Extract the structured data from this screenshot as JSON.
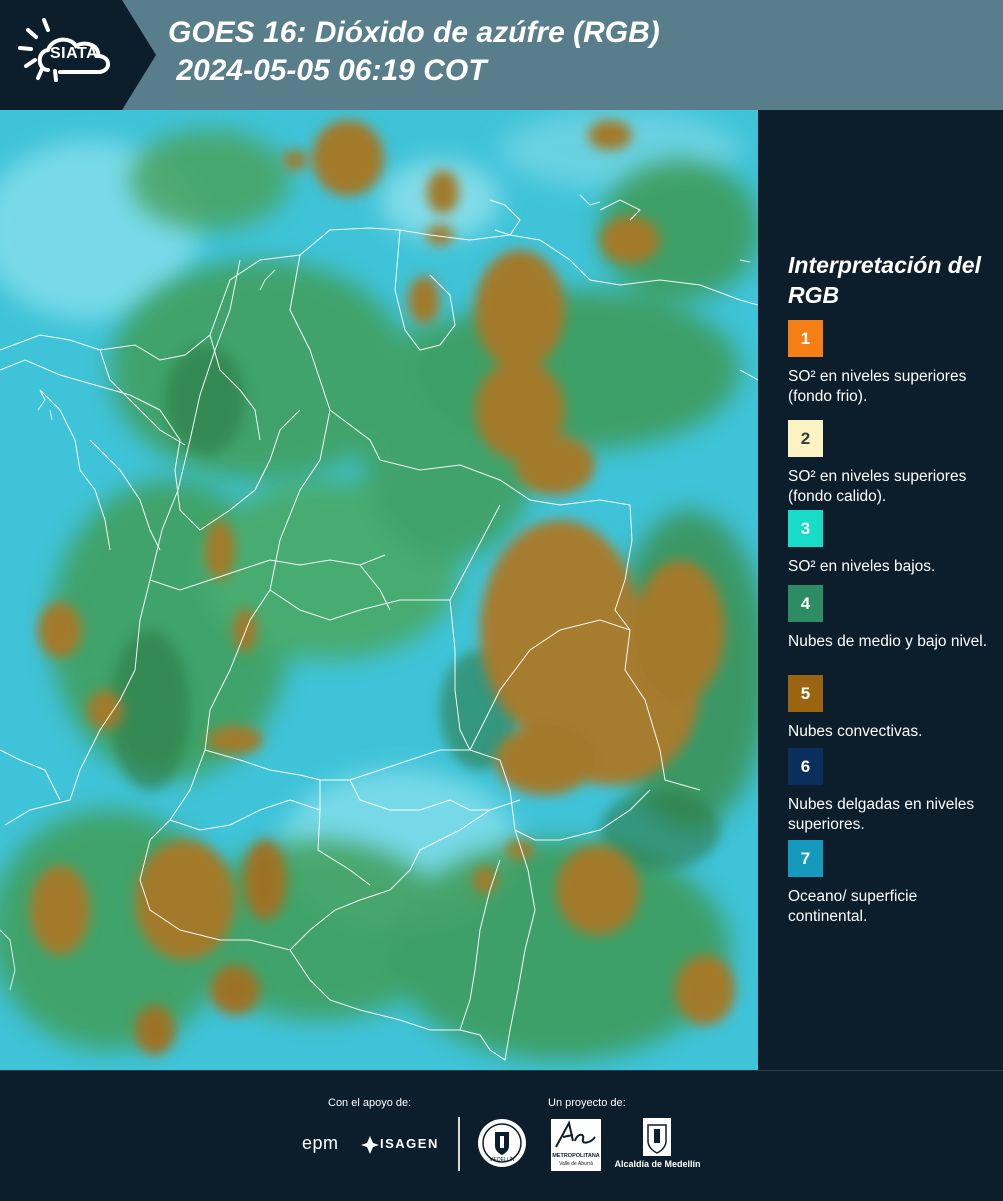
{
  "header": {
    "logo_text": "SIATA",
    "title_line1": "GOES 16: Dióxido de azúfre (RGB)",
    "title_line2": " 2024-05-05 06:19 COT"
  },
  "legend": {
    "title": "Interpretación del RGB",
    "items": [
      {
        "number": "1",
        "label": "SO² en niveles superiores (fondo frio).",
        "color": "#f57f15"
      },
      {
        "number": "2",
        "label": "SO² en niveles superiores (fondo calido).",
        "color": "#fbf3c3"
      },
      {
        "number": "3",
        "label": "SO² en niveles bajos.",
        "color": "#18dcc8"
      },
      {
        "number": "4",
        "label": "Nubes de medio y bajo nivel.",
        "color": "#2e8c64"
      },
      {
        "number": "5",
        "label": "Nubes convectivas.",
        "color": "#9b6411"
      },
      {
        "number": "6",
        "label": "Nubes delgadas en niveles superiores.",
        "color": "#0a2f5c"
      },
      {
        "number": "7",
        "label": "Oceano/ superficie continental.",
        "color": "#1599bd"
      }
    ]
  },
  "footer": {
    "support_label": "Con el apoyo de:",
    "project_label": "Un proyecto de:",
    "epm": "epm",
    "isagen": "ISAGEN",
    "metro_name": "METROPOLITANA",
    "metro_sub": "Valle de Aburrá",
    "alcaldia": "Alcaldía de Medellín",
    "medellin_seal": "MEDELLÍN"
  },
  "colors": {
    "header_bg": "#587d8b",
    "panel_bg": "#0c1e2c",
    "ocean_cyan": "#3fc3d8",
    "convective_brown": "#a27a2c",
    "mid_cloud_green": "#3f9e58"
  }
}
